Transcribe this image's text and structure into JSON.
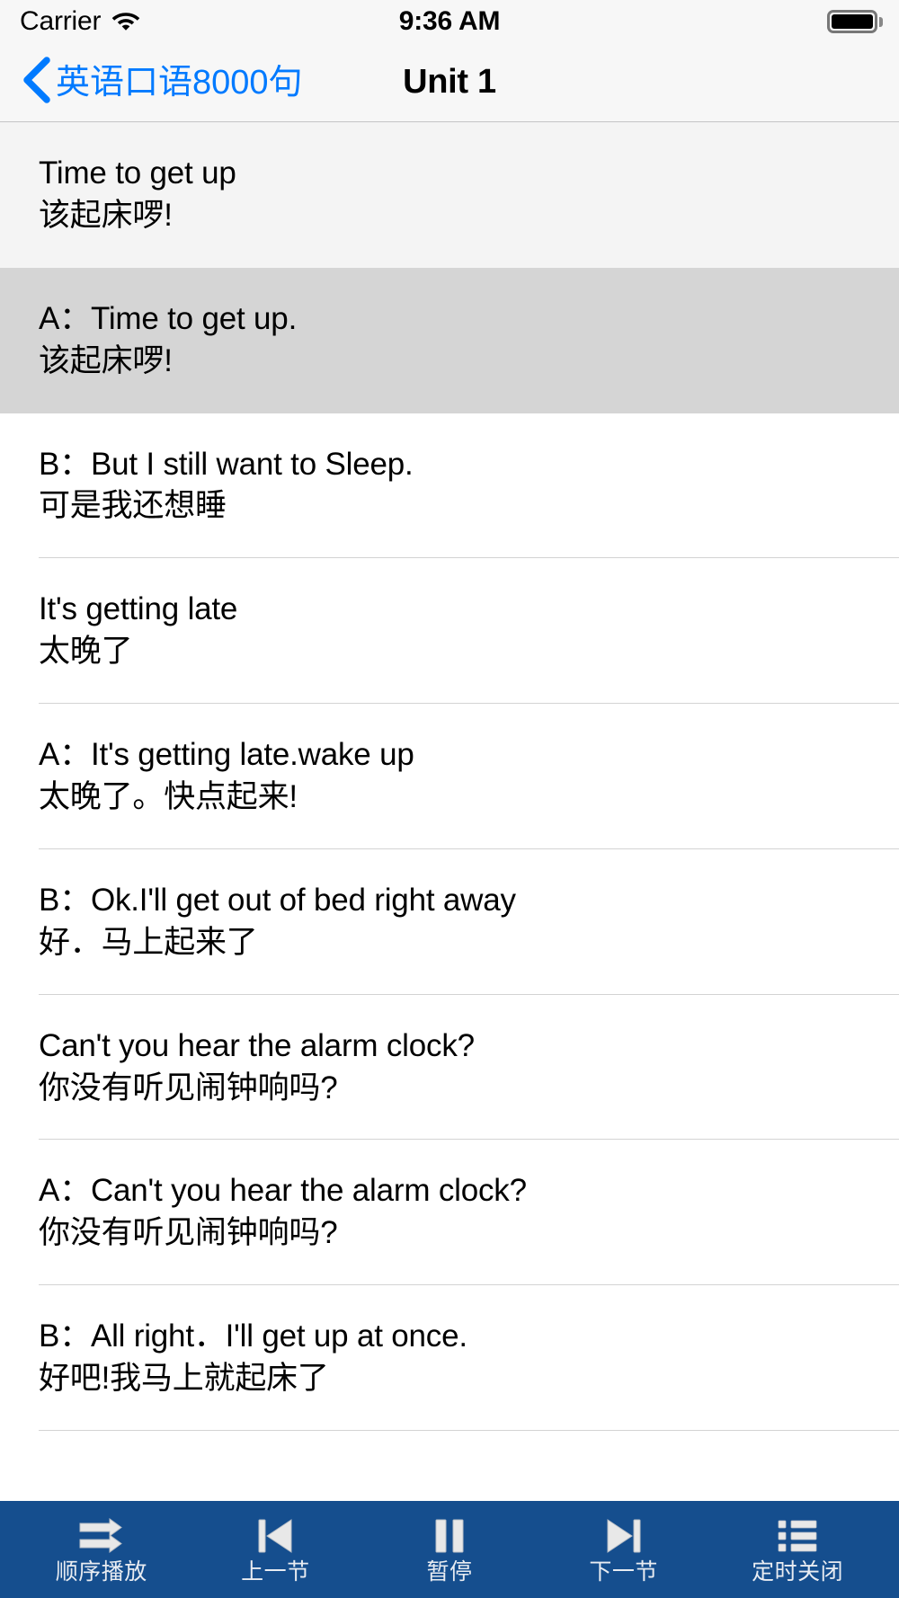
{
  "status_bar": {
    "carrier": "Carrier",
    "wifi_icon": "wifi-icon",
    "time": "9:36 AM",
    "battery_icon": "battery-full-icon"
  },
  "nav_bar": {
    "back_icon": "chevron-left-icon",
    "back_label": "英语口语8000句",
    "title": "Unit 1",
    "accent_color": "#007aff"
  },
  "list": {
    "rows": [
      {
        "en": "Time to get up",
        "cn": "该起床啰!",
        "style": "header"
      },
      {
        "en": "A：Time to get up.",
        "cn": "该起床啰!",
        "style": "selected"
      },
      {
        "en": "B：But I still want to Sleep.",
        "cn": "可是我还想睡",
        "style": "normal"
      },
      {
        "en": "It's getting late",
        "cn": "太晚了",
        "style": "normal"
      },
      {
        "en": "A：It's getting late.wake up",
        "cn": "太晚了。快点起来!",
        "style": "normal"
      },
      {
        "en": "B：Ok.I'll get out of bed right away",
        "cn": "好．马上起来了",
        "style": "normal"
      },
      {
        "en": "Can't you hear the alarm clock?",
        "cn": "你没有听见闹钟响吗?",
        "style": "normal"
      },
      {
        "en": "A：Can't you hear the alarm clock?",
        "cn": "你没有听见闹钟响吗?",
        "style": "normal"
      },
      {
        "en": "B：All right．I'll get up at once.",
        "cn": "好吧!我马上就起床了",
        "style": "normal"
      }
    ]
  },
  "toolbar": {
    "background_color": "#154e8e",
    "items": [
      {
        "icon": "sequential-play-icon",
        "label": "顺序播放"
      },
      {
        "icon": "previous-track-icon",
        "label": "上一节"
      },
      {
        "icon": "pause-icon",
        "label": "暂停"
      },
      {
        "icon": "next-track-icon",
        "label": "下一节"
      },
      {
        "icon": "list-timer-icon",
        "label": "定时关闭"
      }
    ]
  }
}
